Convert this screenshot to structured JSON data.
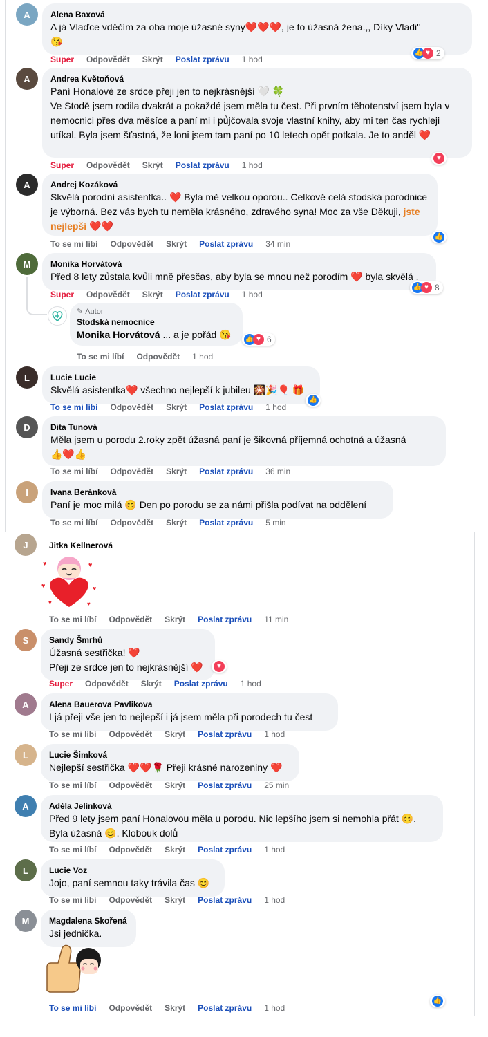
{
  "labels": {
    "super": "Super",
    "like": "To se mi líbí",
    "reply": "Odpovědět",
    "hide": "Skrýt",
    "send": "Poslat zprávu",
    "author_badge": "Autor"
  },
  "comments": [
    {
      "author": "Alena Baxová",
      "text": "A já Vlaďce vděčím za oba moje úžasné syny❤️❤️❤️, je to úžasná žena.,, Díky Vladi''\n😘",
      "time": "1 hod",
      "reaction_count": "2"
    },
    {
      "author": "Andrea Květoňová",
      "text": "Paní Honalové ze srdce přeji jen to nejkrásnější 🤍 🍀\nVe Stodě jsem rodila dvakrát a pokaždé jsem měla tu čest. Při prvním těhotenství jsem byla v nemocnici přes dva měsíce a paní mi i půjčovala svoje vlastní knihy, aby mi ten čas rychleji utíkal. Byla jsem šťastná, že loni jsem tam paní po 10 letech opět potkala. Je to anděl ❤️",
      "time": "1 hod"
    },
    {
      "author": "Andrej Kozáková",
      "text_a": "Skvělá porodní asistentka.. ❤️ Byla mě velkou oporou.. Celkově celá stodská porodnice je výborná. Bez vás bych tu neměla krásného, zdravého syna! Moc za vše Děkuji, ",
      "text_hl": "jste nejlepší",
      "text_b": " ❤️❤️",
      "time": "34 min"
    },
    {
      "author": "Monika Horvátová",
      "text": "Před 8 lety zůstala kvůli mně přesčas, aby byla se mnou než porodím ❤️ byla skvělá .",
      "time": "1 hod",
      "reaction_count": "8"
    },
    {
      "author": "Stodská nemocnice",
      "mention": "Monika Horvátová",
      "text": " ... a je pořád 😘",
      "time": "1 hod",
      "reaction_count": "6"
    },
    {
      "author": "Lucie Lucie",
      "text": "Skvělá asistentka❤️ všechno nejlepší k jubileu 🎇🎉🎈 🎁",
      "time": "1 hod"
    },
    {
      "author": "Dita Tunová",
      "text": "Měla jsem u porodu 2.roky zpět úžasná paní je šikovná příjemná ochotná a úžasná\n👍❤️👍",
      "time": "36 min"
    },
    {
      "author": "Ivana Beránková",
      "text": "Paní je moc milá 😊 Den po porodu se za námi přišla podívat na oddělení",
      "time": "5 min"
    },
    {
      "author": "Jitka Kellnerová",
      "time": "11 min"
    },
    {
      "author": "Sandy Šmrhů",
      "text": "Úžasná sestřička! ❤️\nPřeji ze srdce jen to nejkrásnější ❤️",
      "time": "1 hod"
    },
    {
      "author": "Alena Bauerova Pavlikova",
      "text": "I já přeji vše jen to nejlepší i já jsem měla při porodech tu čest",
      "time": "1 hod"
    },
    {
      "author": "Lucie Šimková",
      "text": "Nejlepší sestřička ❤️❤️🌹 Přeji krásné narozeniny ❤️",
      "time": "25 min"
    },
    {
      "author": "Adéla Jelínková",
      "text": "Před 9 lety jsem paní Honalovou měla u porodu. Nic lepšího jsem si nemohla přát 😊. Byla úžasná 😊. Klobouk dolů",
      "time": "1 hod"
    },
    {
      "author": "Lucie Voz",
      "text": "Jojo, paní semnou taky trávila čas 😊",
      "time": "1 hod"
    },
    {
      "author": "Magdalena Skořená",
      "text": "Jsi jednička.",
      "time": "1 hod"
    }
  ],
  "colors": {
    "like": "#1877f2",
    "love": "#f33e58",
    "super": "#e41e3f",
    "link": "#1b4fb9",
    "bubble": "#f0f2f5",
    "highlight": "#e67e22"
  }
}
